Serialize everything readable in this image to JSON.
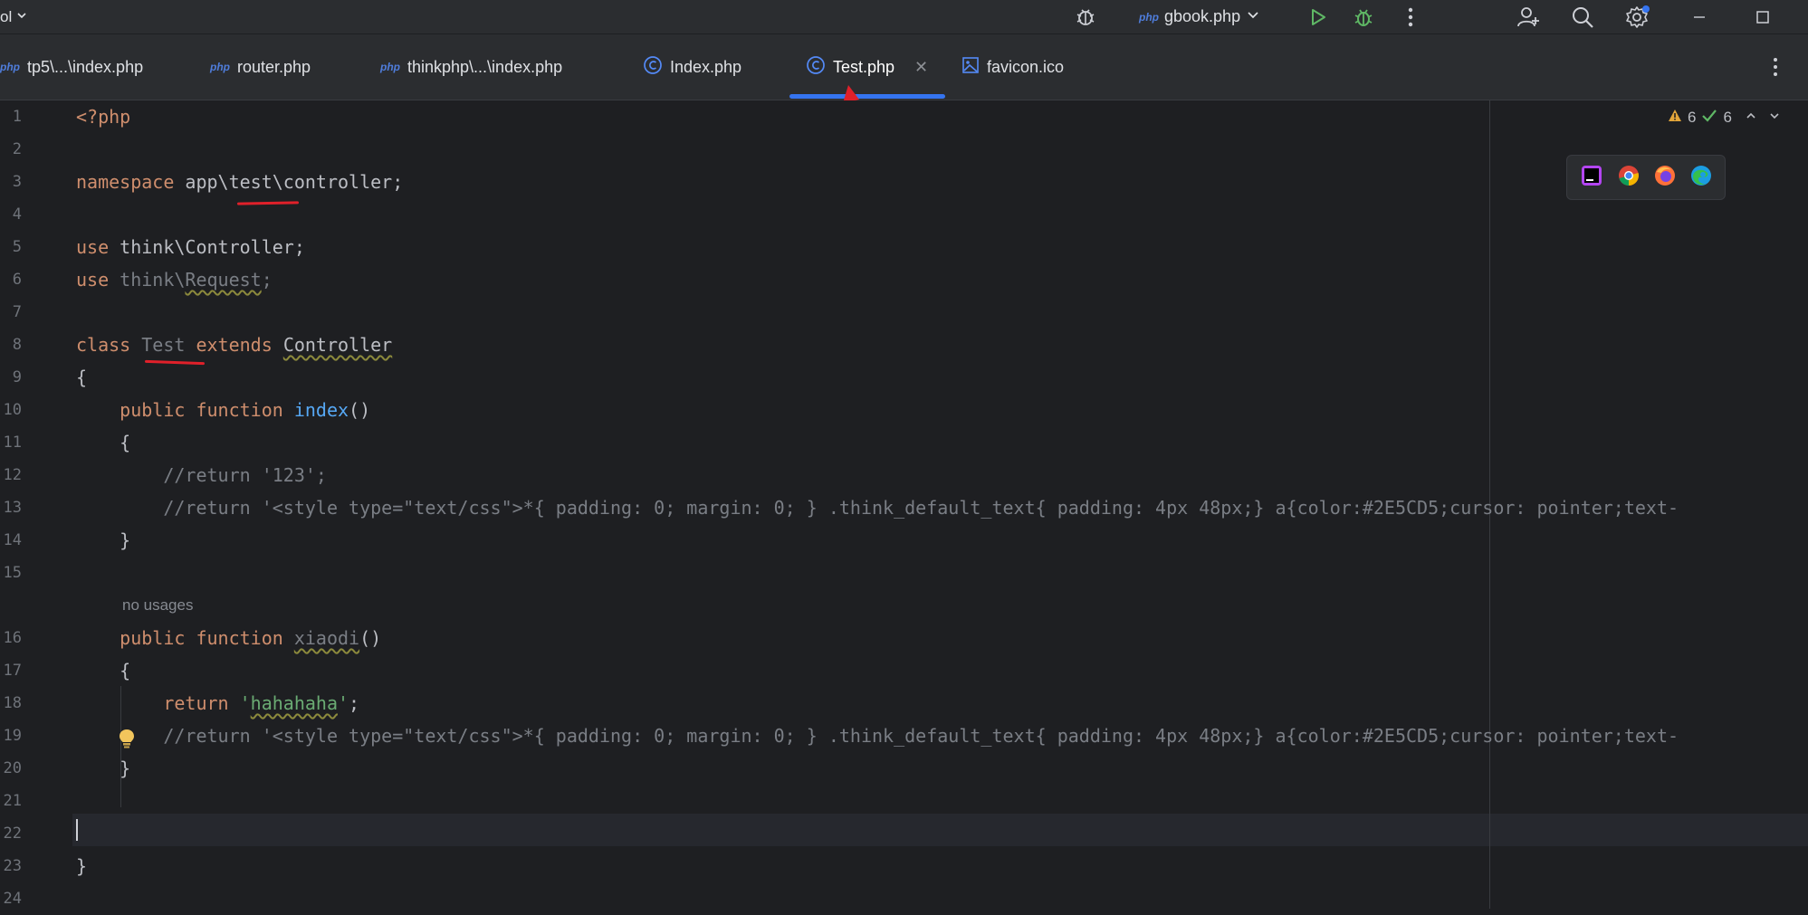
{
  "titlebar": {
    "project_label": "ol",
    "run_config": "gbook.php",
    "run_config_icon_text": "php"
  },
  "tabs": [
    {
      "label": "tp5\\...\\index.php",
      "icon": "php-file-icon",
      "icon_text": "php"
    },
    {
      "label": "router.php",
      "icon": "php-file-icon",
      "icon_text": "php"
    },
    {
      "label": "thinkphp\\...\\index.php",
      "icon": "php-file-icon",
      "icon_text": "php"
    },
    {
      "label": "Index.php",
      "icon": "class-icon"
    },
    {
      "label": "Test.php",
      "icon": "class-icon",
      "active": true
    },
    {
      "label": "favicon.ico",
      "icon": "image-file-icon"
    }
  ],
  "editor": {
    "inspections": {
      "warnings": "6",
      "weak_warnings": "6"
    },
    "inlay_hint": "no usages",
    "lines": {
      "l1": "<?php",
      "l3_kw": "namespace",
      "l3_rest": " app\\test\\controller;",
      "l5_kw": "use",
      "l5_rest": " think\\Controller;",
      "l6_kw": "use",
      "l6_rest_a": " think\\",
      "l6_rest_b": "Request",
      "l6_rest_c": ";",
      "l8_kw": "class",
      "l8_name": " Test",
      "l8_kw2": " extends",
      "l8_sp": " ",
      "l8_parent": "Controller",
      "l9": "{",
      "l10_kw": "    public function",
      "l10_fn": " index",
      "l10_rest": "()",
      "l11": "    {",
      "l12": "        //return '123';",
      "l13": "        //return '<style type=\"text/css\">*{ padding: 0; margin: 0; } .think_default_text{ padding: 4px 48px;} a{color:#2E5CD5;cursor: pointer;text-",
      "l14": "    }",
      "l16_kw": "    public function",
      "l16_sp": " ",
      "l16_fn": "xiaodi",
      "l16_rest": "()",
      "l17": "    {",
      "l18_kw": "        return",
      "l18_sp": " ",
      "l18_q1": "'",
      "l18_str": "hahahaha",
      "l18_q2": "'",
      "l18_end": ";",
      "l19": "        //return '<style type=\"text/css\">*{ padding: 0; margin: 0; } .think_default_text{ padding: 4px 48px;} a{color:#2E5CD5;cursor: pointer;text-",
      "l20": "    }",
      "l23": "}"
    },
    "line_numbers": [
      "1",
      "2",
      "3",
      "4",
      "5",
      "6",
      "7",
      "8",
      "9",
      "10",
      "11",
      "12",
      "13",
      "14",
      "15",
      "16",
      "17",
      "18",
      "19",
      "20",
      "21",
      "22",
      "23",
      "24"
    ]
  }
}
